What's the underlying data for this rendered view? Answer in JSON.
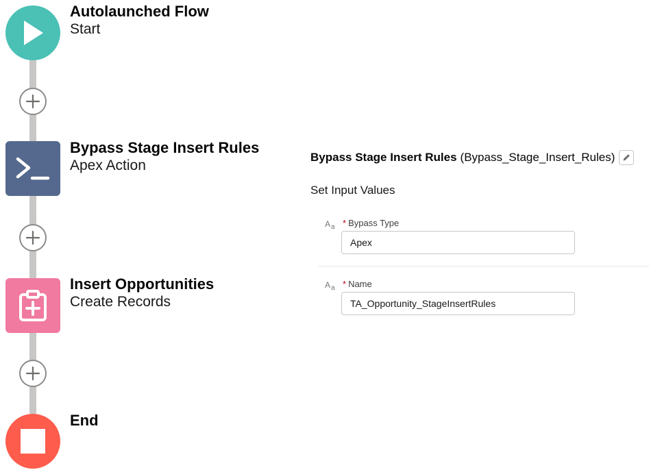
{
  "flow": {
    "nodes": [
      {
        "title": "Autolaunched Flow",
        "subtitle": "Start",
        "icon": "play-icon",
        "color": "#4bc0b5"
      },
      {
        "title": "Bypass Stage Insert Rules",
        "subtitle": "Apex Action",
        "icon": "apex-terminal-icon",
        "color": "#54698d"
      },
      {
        "title": "Insert Opportunities",
        "subtitle": "Create Records",
        "icon": "create-record-icon",
        "color": "#f07aa0"
      },
      {
        "title": "End",
        "subtitle": "",
        "icon": "stop-icon",
        "color": "#fe5c4c"
      }
    ],
    "add_button_icon": "plus-icon",
    "connector_color": "#c9c7c5"
  },
  "panel": {
    "element_label": "Bypass Stage Insert Rules",
    "element_api_name": "(Bypass_Stage_Insert_Rules)",
    "edit_icon": "pencil-icon",
    "section_title": "Set Input Values",
    "fields": [
      {
        "type_icon": "text-type-icon",
        "required_marker": "*",
        "label": "Bypass Type",
        "value": "Apex"
      },
      {
        "type_icon": "text-type-icon",
        "required_marker": "*",
        "label": "Name",
        "value": "TA_Opportunity_StageInsertRules"
      }
    ]
  }
}
